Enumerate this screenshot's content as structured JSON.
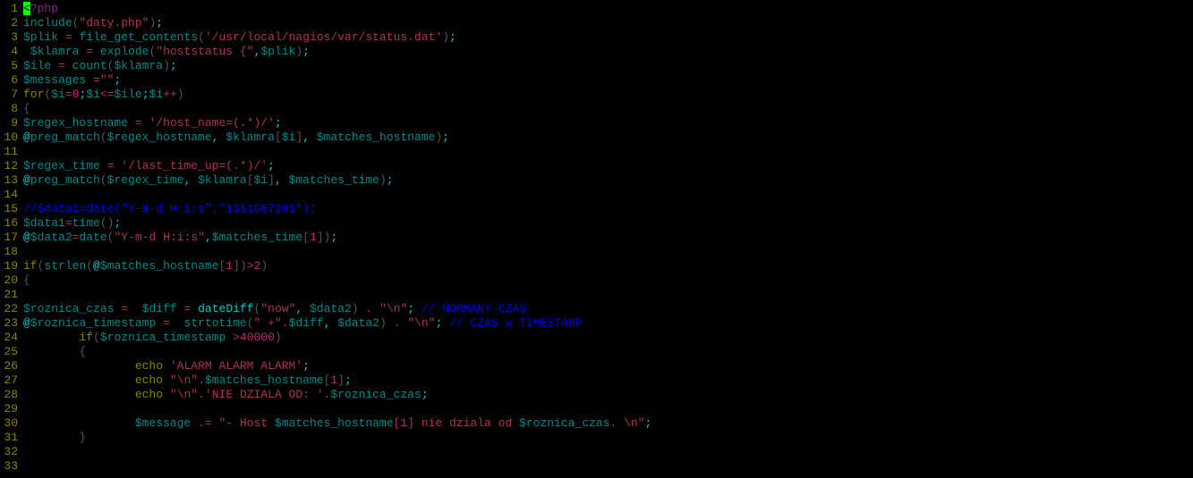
{
  "lines": [
    {
      "n": "1",
      "tokens": [
        {
          "cls": "cursor-block",
          "t": "<"
        },
        {
          "cls": "c-special",
          "t": "?php"
        }
      ]
    },
    {
      "n": "2",
      "tokens": [
        {
          "cls": "c-func",
          "t": "include"
        },
        {
          "cls": "c-paren",
          "t": "("
        },
        {
          "cls": "c-string",
          "t": "\"daty.php\""
        },
        {
          "cls": "c-paren",
          "t": ")"
        },
        {
          "cls": "c-brightcyan",
          "t": ";"
        }
      ]
    },
    {
      "n": "3",
      "tokens": [
        {
          "cls": "c-var",
          "t": "$plik"
        },
        {
          "cls": "",
          "t": " "
        },
        {
          "cls": "c-op",
          "t": "="
        },
        {
          "cls": "",
          "t": " "
        },
        {
          "cls": "c-func",
          "t": "file_get_contents"
        },
        {
          "cls": "c-paren",
          "t": "("
        },
        {
          "cls": "c-string",
          "t": "'/usr/local/nagios/var/status.dat'"
        },
        {
          "cls": "c-paren",
          "t": ")"
        },
        {
          "cls": "c-brightcyan",
          "t": ";"
        }
      ]
    },
    {
      "n": "4",
      "tokens": [
        {
          "cls": "",
          "t": " "
        },
        {
          "cls": "c-var",
          "t": "$klamra"
        },
        {
          "cls": "",
          "t": " "
        },
        {
          "cls": "c-op",
          "t": "="
        },
        {
          "cls": "",
          "t": " "
        },
        {
          "cls": "c-func",
          "t": "explode"
        },
        {
          "cls": "c-paren",
          "t": "("
        },
        {
          "cls": "c-string",
          "t": "\"hoststatus {\""
        },
        {
          "cls": "c-brightcyan",
          "t": ","
        },
        {
          "cls": "c-var",
          "t": "$plik"
        },
        {
          "cls": "c-paren",
          "t": ")"
        },
        {
          "cls": "c-brightcyan",
          "t": ";"
        }
      ]
    },
    {
      "n": "5",
      "tokens": [
        {
          "cls": "c-var",
          "t": "$ile"
        },
        {
          "cls": "",
          "t": " "
        },
        {
          "cls": "c-op",
          "t": "="
        },
        {
          "cls": "",
          "t": " "
        },
        {
          "cls": "c-func",
          "t": "count"
        },
        {
          "cls": "c-paren",
          "t": "("
        },
        {
          "cls": "c-var",
          "t": "$klamra"
        },
        {
          "cls": "c-paren",
          "t": ")"
        },
        {
          "cls": "c-brightcyan",
          "t": ";"
        }
      ]
    },
    {
      "n": "6",
      "tokens": [
        {
          "cls": "c-var",
          "t": "$messages"
        },
        {
          "cls": "",
          "t": " "
        },
        {
          "cls": "c-op",
          "t": "="
        },
        {
          "cls": "c-string",
          "t": "\"\""
        },
        {
          "cls": "c-brightcyan",
          "t": ";"
        }
      ]
    },
    {
      "n": "7",
      "tokens": [
        {
          "cls": "c-kw",
          "t": "for"
        },
        {
          "cls": "c-paren",
          "t": "("
        },
        {
          "cls": "c-var",
          "t": "$i"
        },
        {
          "cls": "c-op",
          "t": "="
        },
        {
          "cls": "c-num",
          "t": "0"
        },
        {
          "cls": "c-brightcyan",
          "t": ";"
        },
        {
          "cls": "c-var",
          "t": "$i"
        },
        {
          "cls": "c-op",
          "t": "<="
        },
        {
          "cls": "c-var",
          "t": "$ile"
        },
        {
          "cls": "c-brightcyan",
          "t": ";"
        },
        {
          "cls": "c-var",
          "t": "$i"
        },
        {
          "cls": "c-op",
          "t": "++"
        },
        {
          "cls": "c-paren",
          "t": ")"
        }
      ]
    },
    {
      "n": "8",
      "tokens": [
        {
          "cls": "c-brace",
          "t": "{"
        }
      ]
    },
    {
      "n": "9",
      "tokens": [
        {
          "cls": "c-var",
          "t": "$regex_hostname"
        },
        {
          "cls": "",
          "t": " "
        },
        {
          "cls": "c-op",
          "t": "="
        },
        {
          "cls": "",
          "t": " "
        },
        {
          "cls": "c-string",
          "t": "'/host_name=(.*)/'"
        },
        {
          "cls": "c-brightcyan",
          "t": ";"
        }
      ]
    },
    {
      "n": "10",
      "tokens": [
        {
          "cls": "c-brightcyan",
          "t": "@"
        },
        {
          "cls": "c-func",
          "t": "preg_match"
        },
        {
          "cls": "c-paren",
          "t": "("
        },
        {
          "cls": "c-var",
          "t": "$regex_hostname"
        },
        {
          "cls": "c-brightcyan",
          "t": ", "
        },
        {
          "cls": "c-var",
          "t": "$klamra"
        },
        {
          "cls": "c-paren",
          "t": "["
        },
        {
          "cls": "c-var",
          "t": "$i"
        },
        {
          "cls": "c-paren",
          "t": "]"
        },
        {
          "cls": "c-brightcyan",
          "t": ", "
        },
        {
          "cls": "c-var",
          "t": "$matches_hostname"
        },
        {
          "cls": "c-paren",
          "t": ")"
        },
        {
          "cls": "c-brightcyan",
          "t": ";"
        }
      ]
    },
    {
      "n": "11",
      "tokens": []
    },
    {
      "n": "12",
      "tokens": [
        {
          "cls": "c-var",
          "t": "$regex_time"
        },
        {
          "cls": "",
          "t": " "
        },
        {
          "cls": "c-op",
          "t": "="
        },
        {
          "cls": "",
          "t": " "
        },
        {
          "cls": "c-string",
          "t": "'/last_time_up=(.*)/'"
        },
        {
          "cls": "c-brightcyan",
          "t": ";"
        }
      ]
    },
    {
      "n": "13",
      "tokens": [
        {
          "cls": "c-brightcyan",
          "t": "@"
        },
        {
          "cls": "c-func",
          "t": "preg_match"
        },
        {
          "cls": "c-paren",
          "t": "("
        },
        {
          "cls": "c-var",
          "t": "$regex_time"
        },
        {
          "cls": "c-brightcyan",
          "t": ", "
        },
        {
          "cls": "c-var",
          "t": "$klamra"
        },
        {
          "cls": "c-paren",
          "t": "["
        },
        {
          "cls": "c-var",
          "t": "$i"
        },
        {
          "cls": "c-paren",
          "t": "]"
        },
        {
          "cls": "c-brightcyan",
          "t": ", "
        },
        {
          "cls": "c-var",
          "t": "$matches_time"
        },
        {
          "cls": "c-paren",
          "t": ")"
        },
        {
          "cls": "c-brightcyan",
          "t": ";"
        }
      ]
    },
    {
      "n": "14",
      "tokens": []
    },
    {
      "n": "15",
      "tokens": [
        {
          "cls": "c-comment",
          "t": "//$data1=date(\"Y-m-d H:i:s\",\"1351087201\");"
        }
      ]
    },
    {
      "n": "16",
      "tokens": [
        {
          "cls": "c-var",
          "t": "$data1"
        },
        {
          "cls": "c-op",
          "t": "="
        },
        {
          "cls": "c-func",
          "t": "time"
        },
        {
          "cls": "c-paren",
          "t": "()"
        },
        {
          "cls": "c-brightcyan",
          "t": ";"
        }
      ]
    },
    {
      "n": "17",
      "tokens": [
        {
          "cls": "c-brightcyan",
          "t": "@"
        },
        {
          "cls": "c-var",
          "t": "$data2"
        },
        {
          "cls": "c-op",
          "t": "="
        },
        {
          "cls": "c-func",
          "t": "date"
        },
        {
          "cls": "c-paren",
          "t": "("
        },
        {
          "cls": "c-string",
          "t": "\"Y-m-d H:i:s\""
        },
        {
          "cls": "c-brightcyan",
          "t": ","
        },
        {
          "cls": "c-var",
          "t": "$matches_time"
        },
        {
          "cls": "c-paren",
          "t": "["
        },
        {
          "cls": "c-num",
          "t": "1"
        },
        {
          "cls": "c-paren",
          "t": "])"
        },
        {
          "cls": "c-brightcyan",
          "t": ";"
        }
      ]
    },
    {
      "n": "18",
      "tokens": []
    },
    {
      "n": "19",
      "tokens": [
        {
          "cls": "c-kw",
          "t": "if"
        },
        {
          "cls": "c-paren",
          "t": "("
        },
        {
          "cls": "c-func",
          "t": "strlen"
        },
        {
          "cls": "c-paren",
          "t": "("
        },
        {
          "cls": "c-brightcyan",
          "t": "@"
        },
        {
          "cls": "c-var",
          "t": "$matches_hostname"
        },
        {
          "cls": "c-paren",
          "t": "["
        },
        {
          "cls": "c-num",
          "t": "1"
        },
        {
          "cls": "c-paren",
          "t": "])"
        },
        {
          "cls": "c-op",
          "t": ">"
        },
        {
          "cls": "c-num",
          "t": "2"
        },
        {
          "cls": "c-paren",
          "t": ")"
        }
      ]
    },
    {
      "n": "20",
      "tokens": [
        {
          "cls": "c-brace",
          "t": "{"
        }
      ]
    },
    {
      "n": "21",
      "tokens": []
    },
    {
      "n": "22",
      "tokens": [
        {
          "cls": "c-var",
          "t": "$roznica_czas"
        },
        {
          "cls": "",
          "t": " "
        },
        {
          "cls": "c-op",
          "t": "="
        },
        {
          "cls": "",
          "t": "  "
        },
        {
          "cls": "c-var",
          "t": "$diff"
        },
        {
          "cls": "",
          "t": " "
        },
        {
          "cls": "c-op",
          "t": "="
        },
        {
          "cls": "",
          "t": " "
        },
        {
          "cls": "c-brightcyan",
          "t": "dateDiff"
        },
        {
          "cls": "c-paren",
          "t": "("
        },
        {
          "cls": "c-string",
          "t": "\"now\""
        },
        {
          "cls": "c-brightcyan",
          "t": ", "
        },
        {
          "cls": "c-var",
          "t": "$data2"
        },
        {
          "cls": "c-paren",
          "t": ")"
        },
        {
          "cls": "",
          "t": " "
        },
        {
          "cls": "c-op",
          "t": "."
        },
        {
          "cls": "",
          "t": " "
        },
        {
          "cls": "c-string",
          "t": "\"\\n\""
        },
        {
          "cls": "c-brightcyan",
          "t": ";"
        },
        {
          "cls": "",
          "t": " "
        },
        {
          "cls": "c-comment",
          "t": "// NORMANY CZAS"
        }
      ]
    },
    {
      "n": "23",
      "tokens": [
        {
          "cls": "c-brightcyan",
          "t": "@"
        },
        {
          "cls": "c-var",
          "t": "$roznica_timestamp"
        },
        {
          "cls": "",
          "t": " "
        },
        {
          "cls": "c-op",
          "t": "="
        },
        {
          "cls": "",
          "t": "  "
        },
        {
          "cls": "c-func",
          "t": "strtotime"
        },
        {
          "cls": "c-paren",
          "t": "("
        },
        {
          "cls": "c-string",
          "t": "\" +\""
        },
        {
          "cls": "c-op",
          "t": "."
        },
        {
          "cls": "c-var",
          "t": "$diff"
        },
        {
          "cls": "c-brightcyan",
          "t": ", "
        },
        {
          "cls": "c-var",
          "t": "$data2"
        },
        {
          "cls": "c-paren",
          "t": ")"
        },
        {
          "cls": "",
          "t": " "
        },
        {
          "cls": "c-op",
          "t": "."
        },
        {
          "cls": "",
          "t": " "
        },
        {
          "cls": "c-string",
          "t": "\"\\n\""
        },
        {
          "cls": "c-brightcyan",
          "t": ";"
        },
        {
          "cls": "",
          "t": " "
        },
        {
          "cls": "c-comment",
          "t": "// CZAS w TIMESTAMP"
        }
      ]
    },
    {
      "n": "24",
      "tokens": [
        {
          "cls": "",
          "t": "        "
        },
        {
          "cls": "c-kw",
          "t": "if"
        },
        {
          "cls": "c-paren",
          "t": "("
        },
        {
          "cls": "c-var",
          "t": "$roznica_timestamp"
        },
        {
          "cls": "",
          "t": " "
        },
        {
          "cls": "c-op",
          "t": ">"
        },
        {
          "cls": "c-num",
          "t": "40000"
        },
        {
          "cls": "c-paren",
          "t": ")"
        }
      ]
    },
    {
      "n": "25",
      "tokens": [
        {
          "cls": "",
          "t": "        "
        },
        {
          "cls": "c-brace",
          "t": "{"
        }
      ]
    },
    {
      "n": "26",
      "tokens": [
        {
          "cls": "",
          "t": "                "
        },
        {
          "cls": "c-kw",
          "t": "echo"
        },
        {
          "cls": "",
          "t": " "
        },
        {
          "cls": "c-string",
          "t": "'ALARM ALARM ALARM'"
        },
        {
          "cls": "c-brightcyan",
          "t": ";"
        }
      ]
    },
    {
      "n": "27",
      "tokens": [
        {
          "cls": "",
          "t": "                "
        },
        {
          "cls": "c-kw",
          "t": "echo"
        },
        {
          "cls": "",
          "t": " "
        },
        {
          "cls": "c-string",
          "t": "\"\\n\""
        },
        {
          "cls": "c-op",
          "t": "."
        },
        {
          "cls": "c-var",
          "t": "$matches_hostname"
        },
        {
          "cls": "c-paren",
          "t": "["
        },
        {
          "cls": "c-num",
          "t": "1"
        },
        {
          "cls": "c-paren",
          "t": "]"
        },
        {
          "cls": "c-brightcyan",
          "t": ";"
        }
      ]
    },
    {
      "n": "28",
      "tokens": [
        {
          "cls": "",
          "t": "                "
        },
        {
          "cls": "c-kw",
          "t": "echo"
        },
        {
          "cls": "",
          "t": " "
        },
        {
          "cls": "c-string",
          "t": "\"\\n\""
        },
        {
          "cls": "c-op",
          "t": "."
        },
        {
          "cls": "c-string",
          "t": "'NIE DZIALA OD: '"
        },
        {
          "cls": "c-op",
          "t": "."
        },
        {
          "cls": "c-var",
          "t": "$roznica_czas"
        },
        {
          "cls": "c-brightcyan",
          "t": ";"
        }
      ]
    },
    {
      "n": "29",
      "tokens": []
    },
    {
      "n": "30",
      "tokens": [
        {
          "cls": "",
          "t": "                "
        },
        {
          "cls": "c-var",
          "t": "$message"
        },
        {
          "cls": "",
          "t": " "
        },
        {
          "cls": "c-op",
          "t": ".="
        },
        {
          "cls": "",
          "t": " "
        },
        {
          "cls": "c-string",
          "t": "\"- Host "
        },
        {
          "cls": "c-var",
          "t": "$matches_hostname"
        },
        {
          "cls": "c-string",
          "t": "["
        },
        {
          "cls": "c-num",
          "t": "1"
        },
        {
          "cls": "c-string",
          "t": "] nie dziala od "
        },
        {
          "cls": "c-var",
          "t": "$roznica_czas"
        },
        {
          "cls": "c-string",
          "t": ". \\n\""
        },
        {
          "cls": "c-brightcyan",
          "t": ";"
        }
      ]
    },
    {
      "n": "31",
      "tokens": [
        {
          "cls": "",
          "t": "        "
        },
        {
          "cls": "c-brace",
          "t": "}"
        }
      ]
    },
    {
      "n": "32",
      "tokens": []
    },
    {
      "n": "33",
      "tokens": []
    }
  ]
}
